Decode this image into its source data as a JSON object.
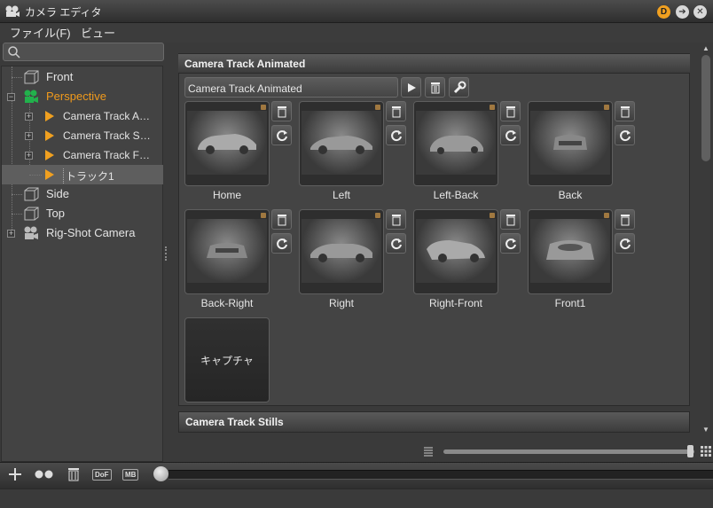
{
  "window": {
    "title": "カメラ エディタ",
    "btn_d": "D"
  },
  "menu": {
    "file": "ファイル(F)",
    "view": "ビュー"
  },
  "search": {
    "placeholder": ""
  },
  "tree": [
    {
      "label": "Front",
      "type": "camera"
    },
    {
      "label": "Perspective",
      "type": "perspective"
    },
    {
      "label": "Camera Track A…",
      "type": "track"
    },
    {
      "label": "Camera Track S…",
      "type": "track"
    },
    {
      "label": "Camera Track F…",
      "type": "track"
    },
    {
      "label": "トラック1",
      "type": "track"
    },
    {
      "label": "Side",
      "type": "camera"
    },
    {
      "label": "Top",
      "type": "camera"
    },
    {
      "label": "Rig-Shot Camera",
      "type": "rig"
    }
  ],
  "panel": {
    "title": "Camera Track Animated",
    "track_name": "Camera Track Animated"
  },
  "thumbs": [
    {
      "label": "Home"
    },
    {
      "label": "Left"
    },
    {
      "label": "Left-Back"
    },
    {
      "label": "Back"
    },
    {
      "label": "Back-Right"
    },
    {
      "label": "Right"
    },
    {
      "label": "Right-Front"
    },
    {
      "label": "Front1"
    }
  ],
  "capture": {
    "label": "キャプチャ"
  },
  "panel2": {
    "title": "Camera Track Stills"
  },
  "bottom": {
    "dof": "DoF",
    "mb": "MB"
  },
  "colors": {
    "accent": "#f09a1c",
    "perspective_icon": "#22b14c"
  }
}
